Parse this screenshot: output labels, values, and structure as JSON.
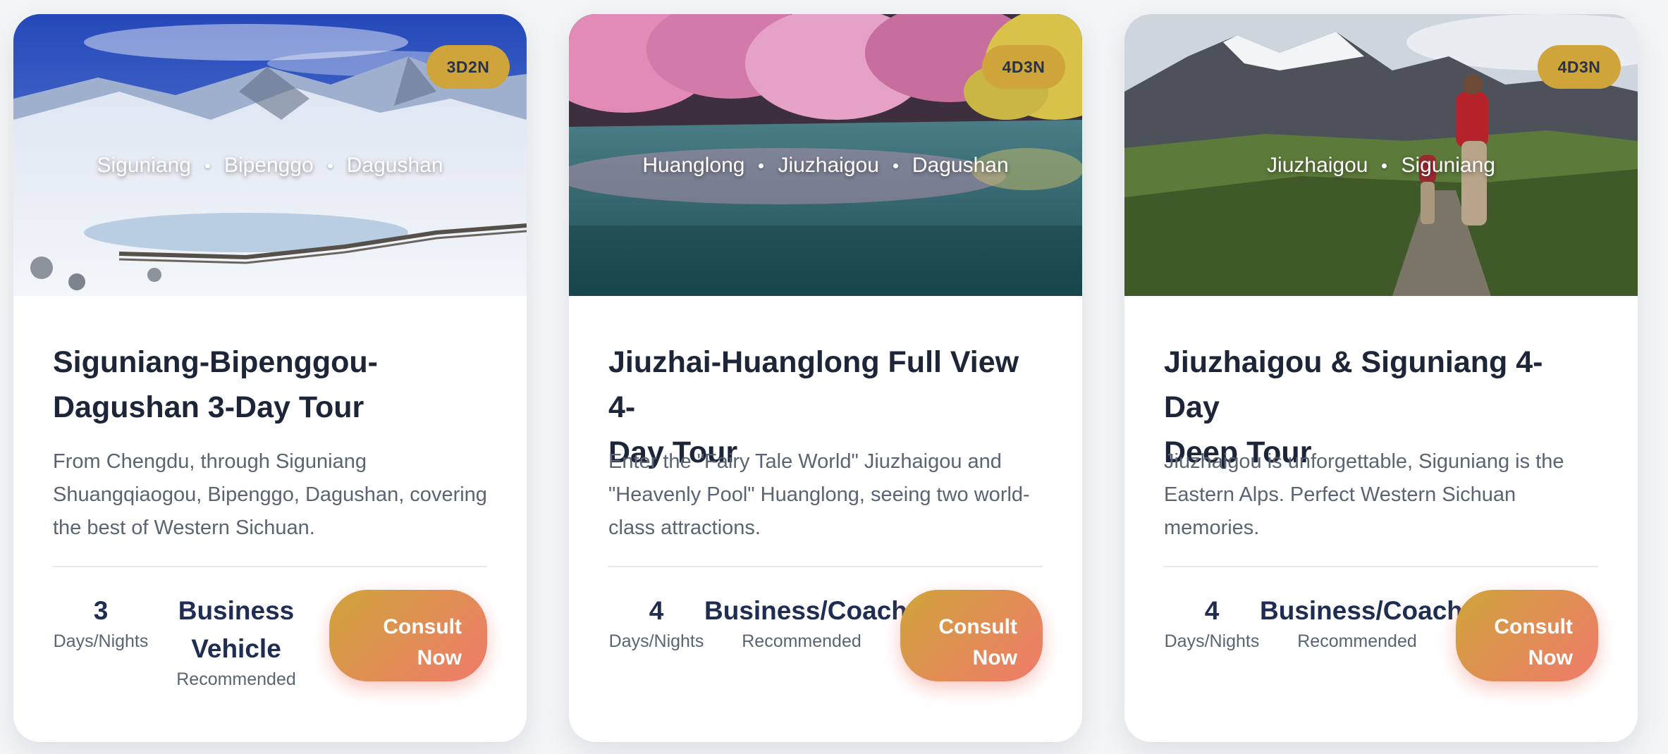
{
  "cards": [
    {
      "badge": "3D2N",
      "route": [
        "Siguniang",
        "Bipenggo",
        "Dagushan"
      ],
      "title_line1": "Siguniang-Bipenggou-",
      "title_line2": "Dagushan 3-Day Tour",
      "description": "From Chengdu, through Siguniang Shuangqiaogou, Bipenggo, Dagushan, covering the best of Western Sichuan.",
      "days_value": "3",
      "days_label": "Days/Nights",
      "vehicle_line1": "Business",
      "vehicle_line2": "Vehicle",
      "vehicle_label": "Recommended",
      "button_label": "Consult\nNow"
    },
    {
      "badge": "4D3N",
      "route": [
        "Huanglong",
        "Jiuzhaigou",
        "Dagushan"
      ],
      "title_line1": "Jiuzhai-Huanglong Full View 4-",
      "title_line2": "Day Tour",
      "description": "Enter the \"Fairy Tale World\" Jiuzhaigou and \"Heavenly Pool\" Huanglong, seeing two world-class attractions.",
      "days_value": "4",
      "days_label": "Days/Nights",
      "vehicle": "Business/Coach",
      "vehicle_label": "Recommended",
      "button_label": "Consult\nNow"
    },
    {
      "badge": "4D3N",
      "route": [
        "Jiuzhaigou",
        "Siguniang"
      ],
      "title_line1": "Jiuzhaigou & Siguniang 4-Day",
      "title_line2": "Deep Tour",
      "description": "Jiuzhaigou is unforgettable, Siguniang is the Eastern Alps. Perfect Western Sichuan memories.",
      "days_value": "4",
      "days_label": "Days/Nights",
      "vehicle": "Business/Coach",
      "vehicle_label": "Recommended",
      "button_label": "Consult\nNow"
    }
  ],
  "colors": {
    "badge": "#cfa43a",
    "title": "#1d2638",
    "stat": "#1f2d52",
    "button_start": "#cfa43a",
    "button_end": "#f07a6c"
  },
  "images": [
    "snowy-mountain-lake-boardwalk",
    "cherry-blossom-lake-reflection",
    "hikers-mountain-trail"
  ]
}
